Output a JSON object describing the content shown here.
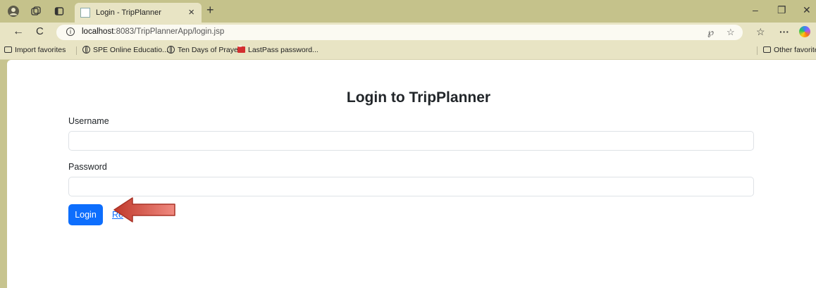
{
  "browser": {
    "tab": {
      "title": "Login - TripPlanner",
      "close_glyph": "×"
    },
    "new_tab_glyph": "+",
    "window_controls": {
      "minimize": "–",
      "restore": "❐",
      "close": "✕"
    },
    "nav": {
      "back_glyph": "←",
      "refresh_glyph": "C"
    },
    "address": {
      "host": "localhost",
      "path": ":8083/TripPlannerApp/login.jsp",
      "info_glyph": "i"
    },
    "address_icons": {
      "read_aloud": "℘",
      "favorite": "☆"
    },
    "toolbar_icons": {
      "favorites": "☆",
      "more": "···"
    },
    "favorites": [
      {
        "label": "Import favorites",
        "icon": "folder-icon"
      },
      {
        "label": "SPE Online Educatio...",
        "icon": "globe-icon"
      },
      {
        "label": "Ten Days of Prayer",
        "icon": "globe-icon"
      },
      {
        "label": "LastPass password...",
        "icon": "lastpass-icon"
      }
    ],
    "other_favorites": "Other favorites"
  },
  "page": {
    "heading": "Login to TripPlanner",
    "username_label": "Username",
    "username_value": "",
    "password_label": "Password",
    "password_value": "",
    "login_button": "Login",
    "register_link": "Re"
  },
  "colors": {
    "primary": "#0d6efd",
    "chrome": "#c5c28b",
    "toolbar": "#e8e4c4",
    "annotation_arrow": "#e0635e"
  }
}
